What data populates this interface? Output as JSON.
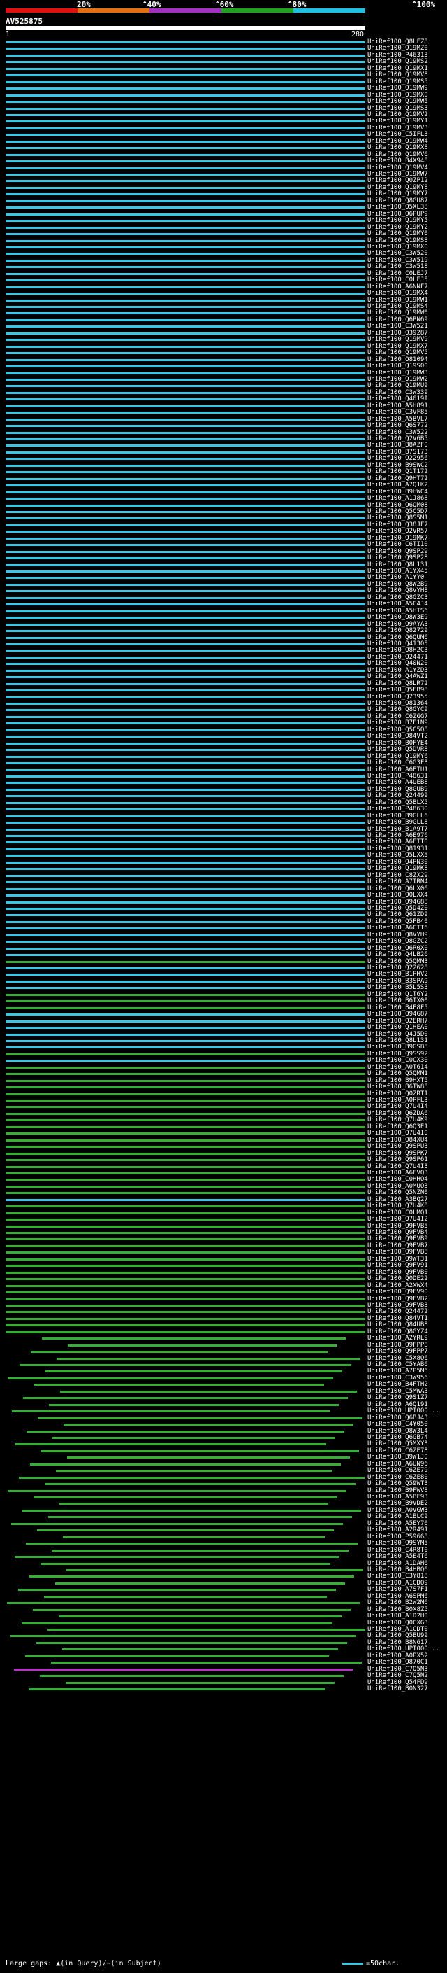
{
  "legend": {
    "labels": [
      "20%",
      "^40%",
      "^60%",
      "^80%",
      "^100%"
    ],
    "colors": [
      "#e01010",
      "#e07010",
      "#a030c0",
      "#20a020",
      "#20c0e0"
    ]
  },
  "query": {
    "id": "AV525875",
    "start": "1",
    "end": "280"
  },
  "colors": {
    "cyan": "#37c6e6",
    "green": "#33b033",
    "magenta": "#c030d0",
    "white": "#ffffff"
  },
  "hits": [
    {
      "label": "UniRef100_Q8LFZ8",
      "color": "cyan"
    },
    {
      "label": "UniRef100_Q19MZ0",
      "color": "cyan"
    },
    {
      "label": "UniRef100_P46313",
      "color": "cyan"
    },
    {
      "label": "UniRef100_Q19MS2",
      "color": "cyan"
    },
    {
      "label": "UniRef100_Q19MX1",
      "color": "cyan"
    },
    {
      "label": "UniRef100_Q19MV8",
      "color": "cyan"
    },
    {
      "label": "UniRef100_Q19MS5",
      "color": "cyan"
    },
    {
      "label": "UniRef100_Q19MW9",
      "color": "cyan"
    },
    {
      "label": "UniRef100_Q19MX0",
      "color": "cyan"
    },
    {
      "label": "UniRef100_Q19MW5",
      "color": "cyan"
    },
    {
      "label": "UniRef100_Q19MS3",
      "color": "cyan"
    },
    {
      "label": "UniRef100_Q19MV2",
      "color": "cyan"
    },
    {
      "label": "UniRef100_Q19MY1",
      "color": "cyan"
    },
    {
      "label": "UniRef100_Q19MV3",
      "color": "cyan"
    },
    {
      "label": "UniRef100_C5IFL3",
      "color": "cyan"
    },
    {
      "label": "UniRef100_Q19MW4",
      "color": "cyan"
    },
    {
      "label": "UniRef100_Q19MX8",
      "color": "cyan"
    },
    {
      "label": "UniRef100_Q19MV6",
      "color": "cyan"
    },
    {
      "label": "UniRef100_B4X948",
      "color": "cyan"
    },
    {
      "label": "UniRef100_Q19MV4",
      "color": "cyan"
    },
    {
      "label": "UniRef100_Q19MW7",
      "color": "cyan"
    },
    {
      "label": "UniRef100_Q0ZP12",
      "color": "cyan"
    },
    {
      "label": "UniRef100_Q19MY8",
      "color": "cyan"
    },
    {
      "label": "UniRef100_Q19MY7",
      "color": "cyan"
    },
    {
      "label": "UniRef100_Q8GU87",
      "color": "cyan"
    },
    {
      "label": "UniRef100_Q5XL38",
      "color": "cyan"
    },
    {
      "label": "UniRef100_Q6PUP9",
      "color": "cyan"
    },
    {
      "label": "UniRef100_Q19MY5",
      "color": "cyan"
    },
    {
      "label": "UniRef100_Q19MY2",
      "color": "cyan"
    },
    {
      "label": "UniRef100_Q19MY0",
      "color": "cyan"
    },
    {
      "label": "UniRef100_Q19MS8",
      "color": "cyan"
    },
    {
      "label": "UniRef100_Q19MX0",
      "color": "cyan"
    },
    {
      "label": "UniRef100_C3W520",
      "color": "cyan"
    },
    {
      "label": "UniRef100_C3W519",
      "color": "cyan"
    },
    {
      "label": "UniRef100_C3W518",
      "color": "cyan"
    },
    {
      "label": "UniRef100_C0LEJ7",
      "color": "cyan"
    },
    {
      "label": "UniRef100_C0LEJ5",
      "color": "cyan"
    },
    {
      "label": "UniRef100_A6NNF7",
      "color": "cyan"
    },
    {
      "label": "UniRef100_Q19MX4",
      "color": "cyan"
    },
    {
      "label": "UniRef100_Q19MW1",
      "color": "cyan"
    },
    {
      "label": "UniRef100_Q19MS4",
      "color": "cyan"
    },
    {
      "label": "UniRef100_Q19MW0",
      "color": "cyan"
    },
    {
      "label": "UniRef100_Q6PN69",
      "color": "cyan"
    },
    {
      "label": "UniRef100_C3W521",
      "color": "cyan"
    },
    {
      "label": "UniRef100_Q39287",
      "color": "cyan"
    },
    {
      "label": "UniRef100_Q19MV9",
      "color": "cyan"
    },
    {
      "label": "UniRef100_Q19MX7",
      "color": "cyan"
    },
    {
      "label": "UniRef100_Q19MV5",
      "color": "cyan"
    },
    {
      "label": "UniRef100_O81094",
      "color": "cyan"
    },
    {
      "label": "UniRef100_Q19S00",
      "color": "cyan"
    },
    {
      "label": "UniRef100_Q19MW3",
      "color": "cyan"
    },
    {
      "label": "UniRef100_Q19MW2",
      "color": "cyan"
    },
    {
      "label": "UniRef100_Q19MU9",
      "color": "cyan"
    },
    {
      "label": "UniRef100_C3W339",
      "color": "cyan"
    },
    {
      "label": "UniRef100_Q4619I",
      "color": "cyan"
    },
    {
      "label": "UniRef100_A5H891",
      "color": "cyan"
    },
    {
      "label": "UniRef100_C3VF85",
      "color": "cyan"
    },
    {
      "label": "UniRef100_A5BVL7",
      "color": "cyan"
    },
    {
      "label": "UniRef100_Q6S772",
      "color": "cyan"
    },
    {
      "label": "UniRef100_C3W522",
      "color": "cyan"
    },
    {
      "label": "UniRef100_Q2V6B5",
      "color": "cyan"
    },
    {
      "label": "UniRef100_B8AZF0",
      "color": "cyan"
    },
    {
      "label": "UniRef100_B7S173",
      "color": "cyan"
    },
    {
      "label": "UniRef100_O22956",
      "color": "cyan"
    },
    {
      "label": "UniRef100_B9SWC2",
      "color": "cyan"
    },
    {
      "label": "UniRef100_Q1T172",
      "color": "cyan"
    },
    {
      "label": "UniRef100_Q9HT72",
      "color": "cyan"
    },
    {
      "label": "UniRef100_A7Q1K2",
      "color": "cyan"
    },
    {
      "label": "UniRef100_B9HWC4",
      "color": "cyan"
    },
    {
      "label": "UniRef100_A1J868",
      "color": "cyan"
    },
    {
      "label": "UniRef100_Q6QM08",
      "color": "cyan"
    },
    {
      "label": "UniRef100_Q5C5D7",
      "color": "cyan"
    },
    {
      "label": "UniRef100_Q8S5M1",
      "color": "cyan"
    },
    {
      "label": "UniRef100_Q38JF7",
      "color": "cyan"
    },
    {
      "label": "UniRef100_Q2VR57",
      "color": "cyan"
    },
    {
      "label": "UniRef100_Q19MK7",
      "color": "cyan"
    },
    {
      "label": "UniRef100_C6TI10",
      "color": "cyan"
    },
    {
      "label": "UniRef100_Q9SP29",
      "color": "cyan"
    },
    {
      "label": "UniRef100_Q9SP28",
      "color": "cyan"
    },
    {
      "label": "UniRef100_Q8L131",
      "color": "cyan"
    },
    {
      "label": "UniRef100_A1YX45",
      "color": "cyan"
    },
    {
      "label": "UniRef100_A1YY0",
      "color": "cyan"
    },
    {
      "label": "UniRef100_Q8W2B9",
      "color": "cyan"
    },
    {
      "label": "UniRef100_Q8VYH8",
      "color": "cyan"
    },
    {
      "label": "UniRef100_Q8GZC3",
      "color": "cyan"
    },
    {
      "label": "UniRef100_A5C4J4",
      "color": "cyan"
    },
    {
      "label": "UniRef100_A5HTS6",
      "color": "cyan"
    },
    {
      "label": "UniRef100_Q8W3E9",
      "color": "cyan"
    },
    {
      "label": "UniRef100_Q9AYA3",
      "color": "cyan"
    },
    {
      "label": "UniRef100_Q82729",
      "color": "cyan"
    },
    {
      "label": "UniRef100_Q6QUM6",
      "color": "cyan"
    },
    {
      "label": "UniRef100_Q41305",
      "color": "cyan"
    },
    {
      "label": "UniRef100_Q8H2C3",
      "color": "cyan"
    },
    {
      "label": "UniRef100_Q24471",
      "color": "cyan"
    },
    {
      "label": "UniRef100_Q40N20",
      "color": "cyan"
    },
    {
      "label": "UniRef100_A1YZD3",
      "color": "cyan"
    },
    {
      "label": "UniRef100_Q4AWZ1",
      "color": "cyan"
    },
    {
      "label": "UniRef100_Q8LR72",
      "color": "cyan"
    },
    {
      "label": "UniRef100_Q5FB98",
      "color": "cyan"
    },
    {
      "label": "UniRef100_Q23955",
      "color": "cyan"
    },
    {
      "label": "UniRef100_Q81364",
      "color": "cyan"
    },
    {
      "label": "UniRef100_Q8GYC9",
      "color": "cyan"
    },
    {
      "label": "UniRef100_C6ZGG7",
      "color": "cyan"
    },
    {
      "label": "UniRef100_B7F1N9",
      "color": "cyan"
    },
    {
      "label": "UniRef100_Q5C5Q8",
      "color": "cyan"
    },
    {
      "label": "UniRef100_Q84VT2",
      "color": "cyan"
    },
    {
      "label": "UniRef100_B0FYE4",
      "color": "cyan"
    },
    {
      "label": "UniRef100_Q5DVR8",
      "color": "cyan"
    },
    {
      "label": "UniRef100_Q19MY6",
      "color": "cyan"
    },
    {
      "label": "UniRef100_C6G3F3",
      "color": "cyan"
    },
    {
      "label": "UniRef100_A6ETU1",
      "color": "cyan"
    },
    {
      "label": "UniRef100_P48631",
      "color": "cyan"
    },
    {
      "label": "UniRef100_A4UEB8",
      "color": "cyan"
    },
    {
      "label": "UniRef100_Q8GUB9",
      "color": "cyan"
    },
    {
      "label": "UniRef100_Q24499",
      "color": "cyan"
    },
    {
      "label": "UniRef100_Q5BLX5",
      "color": "cyan"
    },
    {
      "label": "UniRef100_P48630",
      "color": "cyan"
    },
    {
      "label": "UniRef100_B9GLL6",
      "color": "cyan"
    },
    {
      "label": "UniRef100_B9GLL8",
      "color": "cyan"
    },
    {
      "label": "UniRef100_B1A9T7",
      "color": "cyan"
    },
    {
      "label": "UniRef100_A6E976",
      "color": "cyan"
    },
    {
      "label": "UniRef100_A6ETT0",
      "color": "cyan"
    },
    {
      "label": "UniRef100_Q81931",
      "color": "cyan"
    },
    {
      "label": "UniRef100_Q5LXX5",
      "color": "cyan"
    },
    {
      "label": "UniRef100_Q4PN30",
      "color": "cyan"
    },
    {
      "label": "UniRef100_Q19MK8",
      "color": "cyan"
    },
    {
      "label": "UniRef100_C8ZX29",
      "color": "cyan"
    },
    {
      "label": "UniRef100_A7IRN4",
      "color": "cyan"
    },
    {
      "label": "UniRef100_Q6LX06",
      "color": "cyan"
    },
    {
      "label": "UniRef100_Q0LXX4",
      "color": "cyan"
    },
    {
      "label": "UniRef100_Q94G88",
      "color": "cyan"
    },
    {
      "label": "UniRef100_Q5D4Z0",
      "color": "cyan"
    },
    {
      "label": "UniRef100_Q61ZD9",
      "color": "cyan"
    },
    {
      "label": "UniRef100_Q5FB40",
      "color": "cyan"
    },
    {
      "label": "UniRef100_A6CTT6",
      "color": "cyan"
    },
    {
      "label": "UniRef100_Q8VYH9",
      "color": "cyan"
    },
    {
      "label": "UniRef100_Q8GZC2",
      "color": "cyan"
    },
    {
      "label": "UniRef100_Q6R0X0",
      "color": "cyan"
    },
    {
      "label": "UniRef100_Q4LB26",
      "color": "cyan"
    },
    {
      "label": "UniRef100_Q5QMM3",
      "color": "green"
    },
    {
      "label": "UniRef100_Q22628",
      "color": "cyan"
    },
    {
      "label": "UniRef100_B1PHV2",
      "color": "cyan"
    },
    {
      "label": "UniRef100_B3SPA9",
      "color": "cyan"
    },
    {
      "label": "UniRef100_B5L5S3",
      "color": "cyan"
    },
    {
      "label": "UniRef100_Q1T6Y2",
      "color": "green"
    },
    {
      "label": "UniRef100_B6TX00",
      "color": "green"
    },
    {
      "label": "UniRef100_B4F8F5",
      "color": "green"
    },
    {
      "label": "UniRef100_Q94G87",
      "color": "cyan"
    },
    {
      "label": "UniRef100_Q2ERH7",
      "color": "cyan"
    },
    {
      "label": "UniRef100_Q1HEA0",
      "color": "cyan"
    },
    {
      "label": "UniRef100_Q4J5D0",
      "color": "cyan"
    },
    {
      "label": "UniRef100_Q8L131",
      "color": "cyan"
    },
    {
      "label": "UniRef100_B9GSB8",
      "color": "cyan"
    },
    {
      "label": "UniRef100_Q9SS92",
      "color": "green"
    },
    {
      "label": "UniRef100_C0CX30",
      "color": "cyan"
    },
    {
      "label": "UniRef100_A0T614",
      "color": "green"
    },
    {
      "label": "UniRef100_Q5QMM1",
      "color": "green"
    },
    {
      "label": "UniRef100_B9HXT5",
      "color": "green"
    },
    {
      "label": "UniRef100_B6TW88",
      "color": "green"
    },
    {
      "label": "UniRef100_Q0ZRT1",
      "color": "green"
    },
    {
      "label": "UniRef100_A0PFL3",
      "color": "green"
    },
    {
      "label": "UniRef100_Q7U4I4",
      "color": "green"
    },
    {
      "label": "UniRef100_Q6ZDA6",
      "color": "green"
    },
    {
      "label": "UniRef100_Q7U4K9",
      "color": "green"
    },
    {
      "label": "UniRef100_Q6Q3E1",
      "color": "green"
    },
    {
      "label": "UniRef100_Q7U4I0",
      "color": "green"
    },
    {
      "label": "UniRef100_Q84XU4",
      "color": "green"
    },
    {
      "label": "UniRef100_Q9SPU3",
      "color": "green"
    },
    {
      "label": "UniRef100_Q9SPK7",
      "color": "green"
    },
    {
      "label": "UniRef100_Q9SP61",
      "color": "green"
    },
    {
      "label": "UniRef100_Q7U4I3",
      "color": "green"
    },
    {
      "label": "UniRef100_A6EVQ3",
      "color": "green"
    },
    {
      "label": "UniRef100_C0HHQ4",
      "color": "green"
    },
    {
      "label": "UniRef100_A0MUQ3",
      "color": "green"
    },
    {
      "label": "UniRef100_Q5NZN0",
      "color": "green"
    },
    {
      "label": "UniRef100_A3BQ27",
      "color": "cyan"
    },
    {
      "label": "UniRef100_Q7U4K8",
      "color": "green"
    },
    {
      "label": "UniRef100_C0LMQ1",
      "color": "green"
    },
    {
      "label": "UniRef100_Q7U4I2",
      "color": "green"
    },
    {
      "label": "UniRef100_Q9FVB5",
      "color": "green"
    },
    {
      "label": "UniRef100_Q9FVB4",
      "color": "green"
    },
    {
      "label": "UniRef100_Q9FVB9",
      "color": "green"
    },
    {
      "label": "UniRef100_Q9FVB7",
      "color": "green"
    },
    {
      "label": "UniRef100_Q9FVB8",
      "color": "green"
    },
    {
      "label": "UniRef100_Q9WT31",
      "color": "green"
    },
    {
      "label": "UniRef100_Q9FV91",
      "color": "green"
    },
    {
      "label": "UniRef100_Q9FVB0",
      "color": "green"
    },
    {
      "label": "UniRef100_Q0DE22",
      "color": "green"
    },
    {
      "label": "UniRef100_A2XWX4",
      "color": "green"
    },
    {
      "label": "UniRef100_Q9FV90",
      "color": "green"
    },
    {
      "label": "UniRef100_Q9FVB2",
      "color": "green"
    },
    {
      "label": "UniRef100_Q9FVB3",
      "color": "green"
    },
    {
      "label": "UniRef100_Q24472",
      "color": "green"
    },
    {
      "label": "UniRef100_Q84VT1",
      "color": "green"
    },
    {
      "label": "UniRef100_Q84UB8",
      "color": "green"
    },
    {
      "label": "UniRef100_Q8GYZ4",
      "color": "green"
    },
    {
      "label": "UniRef100_A2YRL9",
      "color": "green"
    },
    {
      "label": "UniRef100_Q9FPP8",
      "color": "green"
    },
    {
      "label": "UniRef100_Q9FPP7",
      "color": "green"
    },
    {
      "label": "UniRef100_C5X8Q6",
      "color": "green"
    },
    {
      "label": "UniRef100_C5YAB6",
      "color": "green"
    },
    {
      "label": "UniRef100_A7P5M6",
      "color": "green"
    },
    {
      "label": "UniRef100_C3W956",
      "color": "green"
    },
    {
      "label": "UniRef100_B4FTH2",
      "color": "green"
    },
    {
      "label": "UniRef100_C5MWA3",
      "color": "green"
    },
    {
      "label": "UniRef100_Q9S1Z7",
      "color": "green"
    },
    {
      "label": "UniRef100_A6Q191",
      "color": "green"
    },
    {
      "label": "UniRef100_UPI000...",
      "color": "green"
    },
    {
      "label": "UniRef100_Q6BJ43",
      "color": "green"
    },
    {
      "label": "UniRef100_C4Y050",
      "color": "green"
    },
    {
      "label": "UniRef100_Q8W3L4",
      "color": "green"
    },
    {
      "label": "UniRef100_Q6GB74",
      "color": "green"
    },
    {
      "label": "UniRef100_Q5MXY3",
      "color": "green"
    },
    {
      "label": "UniRef100_C6ZE78",
      "color": "green"
    },
    {
      "label": "UniRef100_B9W1J0",
      "color": "green"
    },
    {
      "label": "UniRef100_A6UN96",
      "color": "green"
    },
    {
      "label": "UniRef100_C6ZE79",
      "color": "green"
    },
    {
      "label": "UniRef100_C6ZE80",
      "color": "green"
    },
    {
      "label": "UniRef100_Q59WT3",
      "color": "green"
    },
    {
      "label": "UniRef100_B9FWV8",
      "color": "green"
    },
    {
      "label": "UniRef100_A5BE93",
      "color": "green"
    },
    {
      "label": "UniRef100_B9VDE2",
      "color": "green"
    },
    {
      "label": "UniRef100_A0VGW3",
      "color": "green"
    },
    {
      "label": "UniRef100_A1BLC9",
      "color": "green"
    },
    {
      "label": "UniRef100_A5EY70",
      "color": "green"
    },
    {
      "label": "UniRef100_A2R491",
      "color": "green"
    },
    {
      "label": "UniRef100_P59668",
      "color": "green"
    },
    {
      "label": "UniRef100_Q9SYM5",
      "color": "green"
    },
    {
      "label": "UniRef100_C4R8T0",
      "color": "green"
    },
    {
      "label": "UniRef100_A5E4T6",
      "color": "green"
    },
    {
      "label": "UniRef100_A1DAH6",
      "color": "green"
    },
    {
      "label": "UniRef100_B4HBQ6",
      "color": "green"
    },
    {
      "label": "UniRef100_C3Y818",
      "color": "green"
    },
    {
      "label": "UniRef100_A1CDQ9",
      "color": "green"
    },
    {
      "label": "UniRef100_A7S7F1",
      "color": "green"
    },
    {
      "label": "UniRef100_A6SPM6",
      "color": "green"
    },
    {
      "label": "UniRef100_B2W2M6",
      "color": "green"
    },
    {
      "label": "UniRef100_B0X8Z5",
      "color": "green"
    },
    {
      "label": "UniRef100_A1D2H0",
      "color": "green"
    },
    {
      "label": "UniRef100_Q0CXG3",
      "color": "green"
    },
    {
      "label": "UniRef100_A1CDT0",
      "color": "green"
    },
    {
      "label": "UniRef100_Q5BU99",
      "color": "green"
    },
    {
      "label": "UniRef100_B8N617",
      "color": "green"
    },
    {
      "label": "UniRef100_UPI000...",
      "color": "green"
    },
    {
      "label": "UniRef100_A0PX52",
      "color": "green"
    },
    {
      "label": "UniRef100_Q870C1",
      "color": "green"
    },
    {
      "label": "UniRef100_C7Q5N3",
      "color": "magenta"
    },
    {
      "label": "UniRef100_C7Q5N2",
      "color": "green"
    },
    {
      "label": "UniRef100_Q54FD9",
      "color": "green"
    },
    {
      "label": "UniRef100_B0N327",
      "color": "green"
    }
  ],
  "footer": {
    "large_gaps": "Large gaps: ▲(in Query)/~(in Subject)",
    "scale": "=50char."
  }
}
